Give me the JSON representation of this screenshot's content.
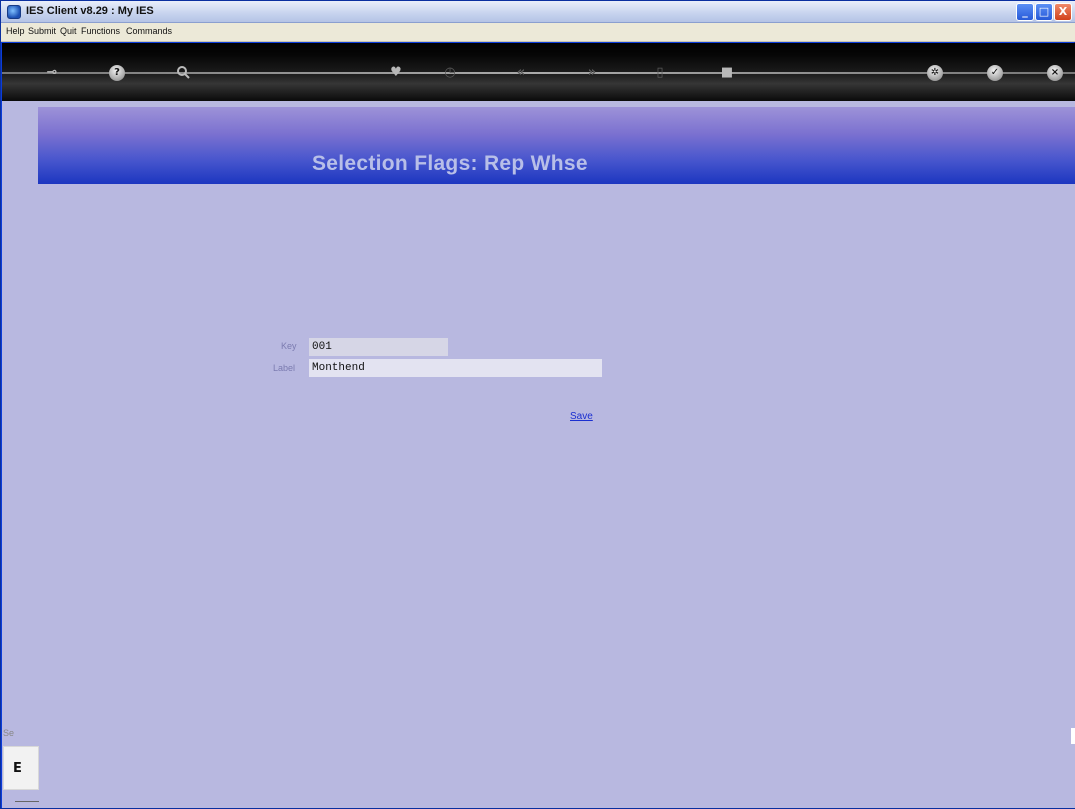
{
  "window": {
    "title": "IES Client v8.29 : My IES",
    "controls": {
      "minimize": "_",
      "maximize": "□",
      "close": "X"
    }
  },
  "menu": {
    "items": [
      "Help",
      "Submit",
      "Quit",
      "Functions",
      "Commands"
    ]
  },
  "toolbar": {
    "icons": [
      {
        "name": "key-icon",
        "glyph": "⊸"
      },
      {
        "name": "help-icon",
        "glyph": "?"
      },
      {
        "name": "search-icon",
        "glyph": "🔍"
      },
      {
        "name": "heart-icon",
        "glyph": "♥"
      },
      {
        "name": "clock-icon",
        "glyph": "◷"
      },
      {
        "name": "rewind-icon",
        "glyph": "«"
      },
      {
        "name": "forward-icon",
        "glyph": "»"
      },
      {
        "name": "document-icon",
        "glyph": "▯"
      },
      {
        "name": "stop-icon",
        "glyph": "■"
      },
      {
        "name": "settings-icon",
        "glyph": "✲"
      },
      {
        "name": "ok-icon",
        "glyph": "✓"
      },
      {
        "name": "cancel-icon",
        "glyph": "×"
      }
    ]
  },
  "banner": {
    "title": "Selection Flags: Rep Whse"
  },
  "form": {
    "key": {
      "label": "Key",
      "value": "001"
    },
    "label": {
      "label": "Label",
      "value": "Monthend"
    },
    "save_label": "Save"
  },
  "statusbar": {
    "fragment": "Se",
    "cell_glyph": "E"
  }
}
